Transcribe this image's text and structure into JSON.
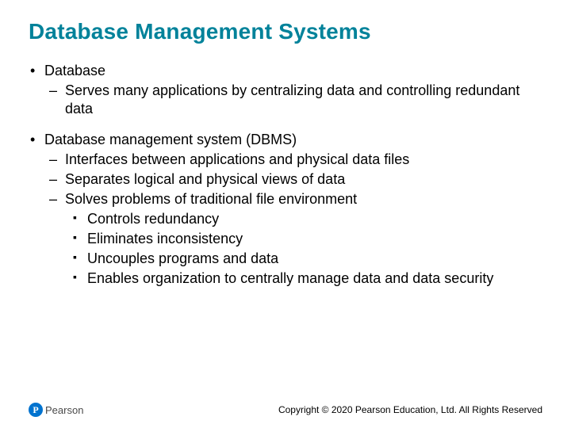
{
  "title": "Database Management Systems",
  "bullets": [
    {
      "text": "Database",
      "children": [
        {
          "text": "Serves many applications by centralizing data and controlling redundant data"
        }
      ]
    },
    {
      "text": "Database management system (DBMS)",
      "children": [
        {
          "text": "Interfaces between applications and physical data files"
        },
        {
          "text": "Separates logical and physical views of data"
        },
        {
          "text": "Solves problems of traditional file environment",
          "children": [
            {
              "text": "Controls redundancy"
            },
            {
              "text": "Eliminates inconsistency"
            },
            {
              "text": "Uncouples programs and data"
            },
            {
              "text": "Enables organization to centrally manage data and data security"
            }
          ]
        }
      ]
    }
  ],
  "logo": {
    "mark": "P",
    "text": "Pearson"
  },
  "copyright": "Copyright © 2020 Pearson Education, Ltd. All Rights Reserved"
}
